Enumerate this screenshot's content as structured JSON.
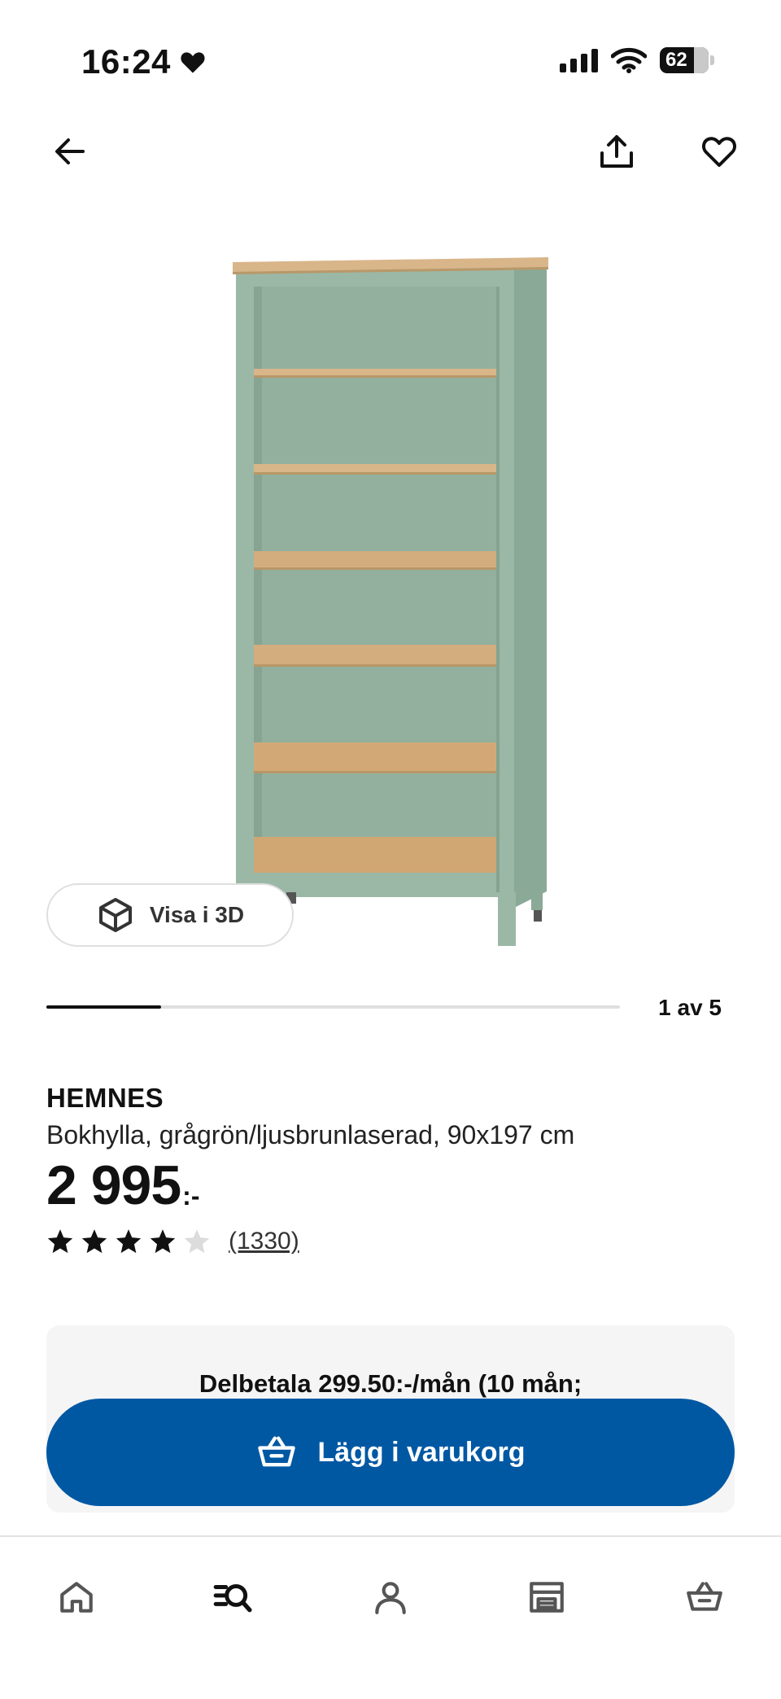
{
  "status_bar": {
    "time": "16:24",
    "battery_percent": "62",
    "battery_level": 0.62,
    "heart_icon": "heart-icon",
    "signal_icon": "signal-icon",
    "wifi_icon": "wifi-icon"
  },
  "top_nav": {
    "back_icon": "arrow-left-icon",
    "share_icon": "share-icon",
    "favorite_icon": "heart-outline-icon"
  },
  "gallery": {
    "view_3d_label": "Visa i 3D",
    "view_3d_icon": "cube-icon",
    "current": 1,
    "total": 5,
    "page_label": "1 av 5",
    "progress": 0.2
  },
  "product": {
    "name": "HEMNES",
    "description": "Bokhylla, grågrön/ljusbrunlaserad, 90x197 cm",
    "price": "2 995",
    "price_suffix": ":-",
    "rating": 4,
    "rating_max": 5,
    "review_count": "(1330)"
  },
  "installment": {
    "text": "Delbetala 299.50:-/mån (10 mån;"
  },
  "cart_button": {
    "label": "Lägg i varukorg",
    "icon": "basket-icon"
  },
  "bottom_nav": {
    "items": [
      {
        "icon": "home-icon"
      },
      {
        "icon": "search-icon"
      },
      {
        "icon": "profile-icon"
      },
      {
        "icon": "store-icon"
      },
      {
        "icon": "basket-icon"
      }
    ]
  },
  "colors": {
    "accent": "#0058a3",
    "shelf_frame": "#9bb8a6",
    "shelf_wood": "#d9b58a"
  }
}
